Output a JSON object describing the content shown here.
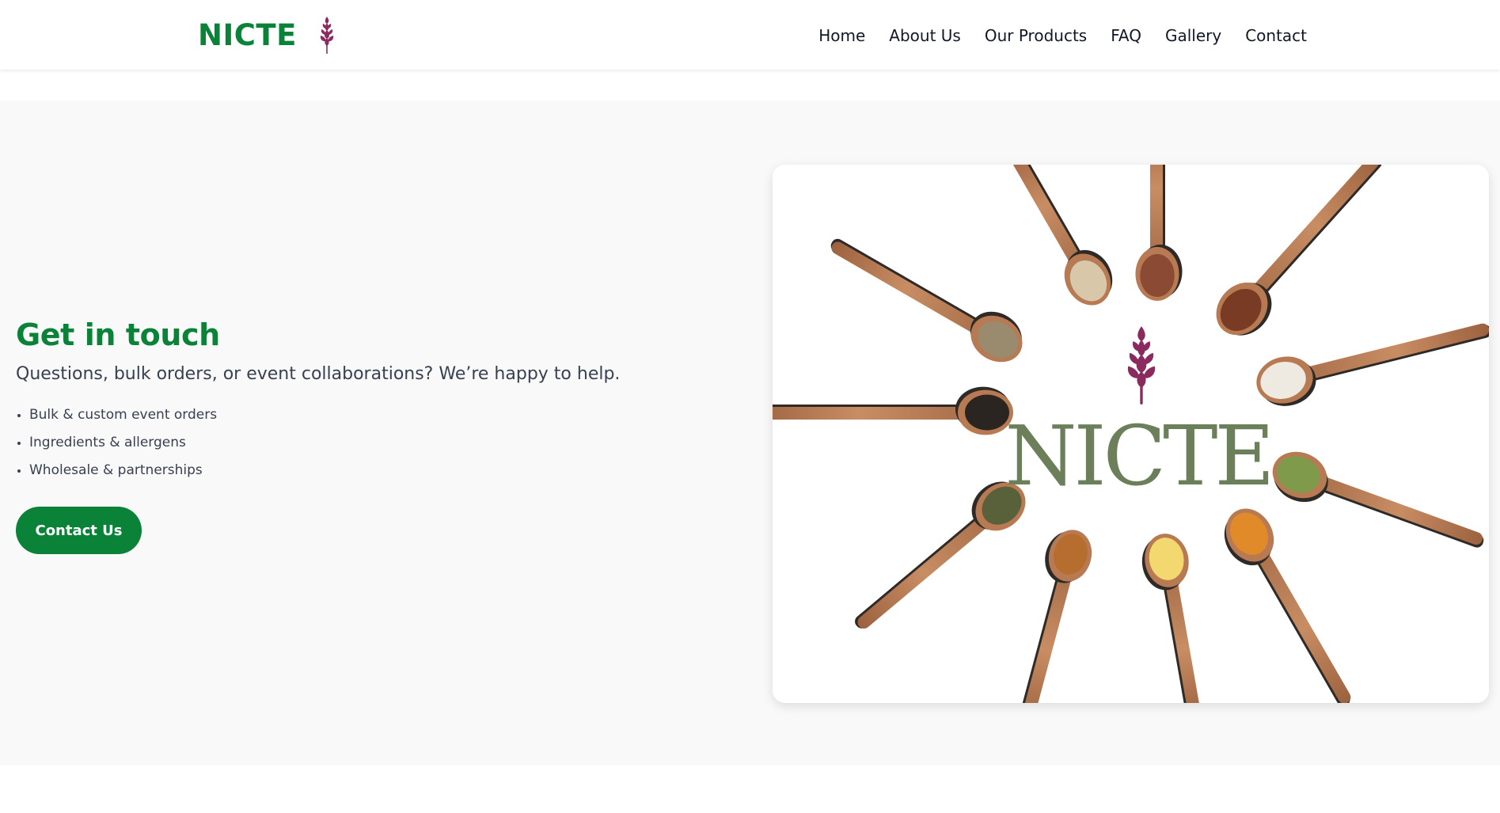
{
  "header": {
    "brand": {
      "name": "NICTE",
      "icon": "amaranth-sprig-icon"
    },
    "nav": [
      {
        "label": "Home"
      },
      {
        "label": "About Us"
      },
      {
        "label": "Our Products"
      },
      {
        "label": "FAQ"
      },
      {
        "label": "Gallery"
      },
      {
        "label": "Contact"
      }
    ]
  },
  "contact": {
    "title": "Get in touch",
    "lead": "Questions, bulk orders, or event collaborations? We’re happy to help.",
    "bullets": [
      "Bulk & custom event orders",
      "Ingredients & allergens",
      "Wholesale & partnerships"
    ],
    "cta_label": "Contact Us"
  },
  "hero_image": {
    "logo_text": "NICTE",
    "icon": "amaranth-sprig-icon"
  },
  "colors": {
    "brand_green": "#0a8237",
    "sprig_magenta": "#8b2a5e",
    "logo_sage": "#6b7f5b",
    "section_bg": "#f9f9f9"
  }
}
